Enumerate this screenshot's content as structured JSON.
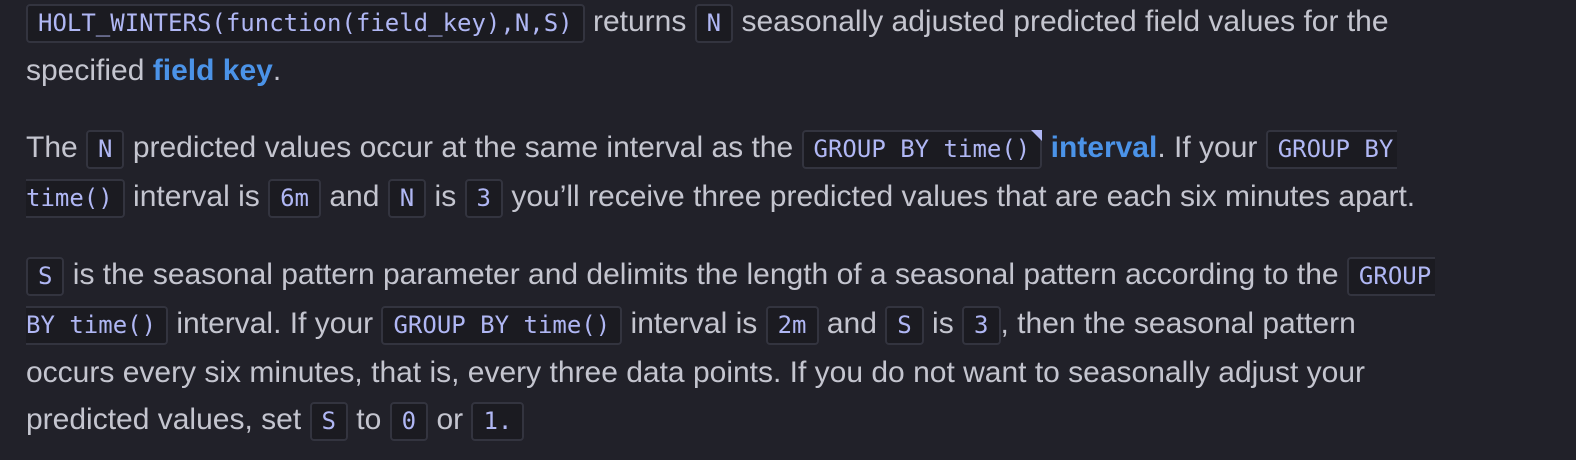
{
  "paragraphs": {
    "p1": {
      "code_holt_winters": "HOLT_WINTERS(function(field_key),N,S)",
      "t1": " returns ",
      "code_n": "N",
      "t2": " seasonally adjusted predicted field values for the",
      "t3": "specified ",
      "link_field_key": "field key",
      "t4": "."
    },
    "p2": {
      "t1": "The ",
      "code_n": "N",
      "t2": " predicted values occur at the same interval as the ",
      "code_group_by": "GROUP BY time()",
      "link_interval": "interval",
      "t3": ". If your ",
      "code_group_by_a": "GROUP BY",
      "code_group_by_b": "time()",
      "t4": " interval is ",
      "code_6m": "6m",
      "t5": " and ",
      "code_n2": "N",
      "t6": " is ",
      "code_3": "3",
      "t7": " you’ll receive three predicted values that are each six minutes apart."
    },
    "p3": {
      "code_s": "S",
      "t1": " is the seasonal pattern parameter and delimits the length of a seasonal pattern according to the ",
      "code_group_a": "GROUP",
      "code_group_b": "BY time()",
      "t2": " interval. If your ",
      "code_group_by": "GROUP BY time()",
      "t3": " interval is ",
      "code_2m": "2m",
      "t4": " and ",
      "code_s2": "S",
      "t5": " is ",
      "code_3": "3",
      "t6": ", then the seasonal pattern",
      "t7": "occurs every six minutes, that is, every three data points. If you do not want to seasonally adjust your",
      "t8": "predicted values, set ",
      "code_s3": "S",
      "t9": " to ",
      "code_0": "0",
      "t10": " or ",
      "code_1": "1."
    }
  }
}
